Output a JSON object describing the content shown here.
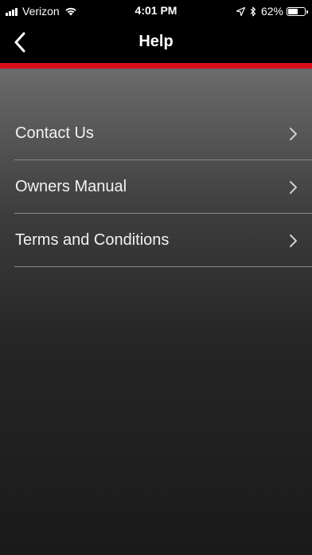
{
  "status_bar": {
    "carrier": "Verizon",
    "time": "4:01 PM",
    "battery_percent": "62%",
    "battery_level": 0.62,
    "icons": [
      "signal-bars-icon",
      "wifi-icon",
      "location-arrow-icon",
      "bluetooth-icon",
      "battery-icon"
    ]
  },
  "nav": {
    "title": "Help",
    "back_icon": "chevron-left-icon"
  },
  "colors": {
    "accent": "#d90e1a",
    "nav_background": "#000000",
    "content_gradient_top": "#6b6b6b",
    "content_gradient_bottom": "#1a1a1a"
  },
  "menu": {
    "items": [
      {
        "label": "Contact Us",
        "icon": "chevron-right-icon"
      },
      {
        "label": "Owners Manual",
        "icon": "chevron-right-icon"
      },
      {
        "label": "Terms and Conditions",
        "icon": "chevron-right-icon"
      }
    ]
  }
}
